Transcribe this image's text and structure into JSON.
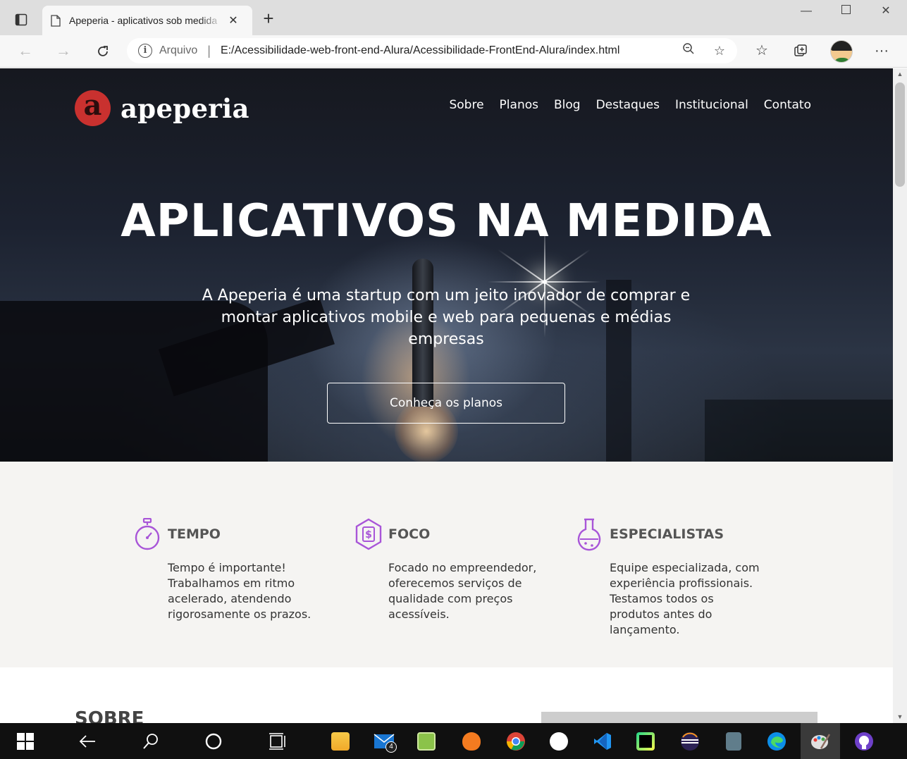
{
  "browser": {
    "tab_title": "Apeperia - aplicativos sob medida",
    "address_label": "Arquivo",
    "address_separator": "|",
    "url": "E:/Acessibilidade-web-front-end-Alura/Acessibilidade-FrontEnd-Alura/index.html"
  },
  "site": {
    "logo_letter": "a",
    "logo_text": "apeperia",
    "brand_color": "#c9312f",
    "accent_color": "#a855d8",
    "menu": [
      "Sobre",
      "Planos",
      "Blog",
      "Destaques",
      "Institucional",
      "Contato"
    ],
    "hero_title": "APLICATIVOS NA MEDIDA",
    "hero_subtitle": "A Apeperia é uma startup com um jeito inovador de comprar e montar aplicativos mobile e web para pequenas e médias empresas",
    "hero_button": "Conheça os planos",
    "features": [
      {
        "icon": "stopwatch-icon",
        "title": "TEMPO",
        "text": "Tempo é importante! Trabalhamos em ritmo acelerado, atendendo rigorosamente os prazos."
      },
      {
        "icon": "dollar-hexagon-icon",
        "title": "FOCO",
        "text": "Focado no empreendedor, oferecemos serviços de qualidade com preços acessíveis."
      },
      {
        "icon": "flask-icon",
        "title": "ESPECIALISTAS",
        "text": "Equipe especializada, com experiência profissionais. Testamos todos os produtos antes do lançamento."
      }
    ],
    "section_title": "SOBRE"
  },
  "taskbar": {
    "mail_badge": "4",
    "apps": [
      "start-icon",
      "back-icon",
      "search-icon",
      "cortana-icon",
      "task-view-icon",
      "file-explorer-icon",
      "mail-icon",
      "notepad-icon",
      "brave-icon",
      "chrome-icon",
      "app-icon",
      "vscode-icon",
      "pycharm-icon",
      "eclipse-icon",
      "calculator-icon",
      "edge-icon",
      "paint-icon",
      "github-icon"
    ]
  }
}
